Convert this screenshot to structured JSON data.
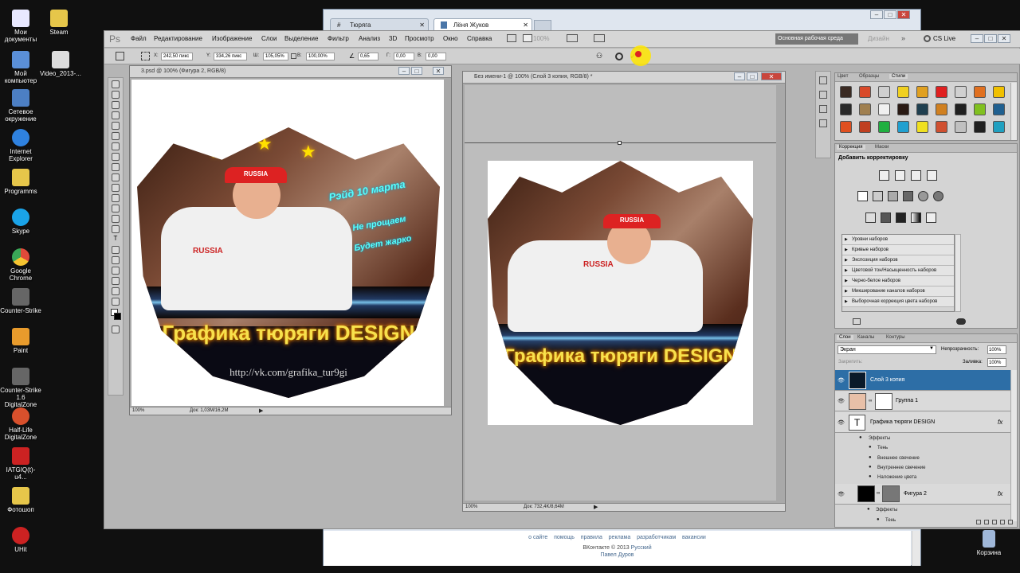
{
  "desktop": {
    "icons": [
      {
        "label": "Мои документы",
        "color": "#e8e8ff"
      },
      {
        "label": "Steam",
        "color": "#e6c64a"
      },
      {
        "label": "Мой компьютер",
        "color": "#5a8fd8"
      },
      {
        "label": "Video_2013-...",
        "color": "#dddddd"
      },
      {
        "label": "Сетевое окружение",
        "color": "#4c7fc4"
      },
      {
        "label": "Internet Explorer",
        "color": "#2f82e0"
      },
      {
        "label": "Programms",
        "color": "#e6c64a"
      },
      {
        "label": "Skype",
        "color": "#1aa3e8"
      },
      {
        "label": "Google Chrome",
        "color": "#e04a3a"
      },
      {
        "label": "Counter-Strike",
        "color": "#666666"
      },
      {
        "label": "Paint",
        "color": "#e89b2c"
      },
      {
        "label": "Counter-Strike 1.6 DigitalZone",
        "color": "#666666"
      },
      {
        "label": "Half-Life DigitalZone",
        "color": "#d8502c"
      },
      {
        "label": "IATGIQ(t)-u4...",
        "color": "#cc2222"
      },
      {
        "label": "Фотошоп",
        "color": "#e6c64a"
      },
      {
        "label": "UHit",
        "color": "#cc2222"
      }
    ],
    "recycle_bin": "Корзина"
  },
  "browser": {
    "tabs": [
      {
        "label": "Тюряга",
        "active": false
      },
      {
        "label": "Лёня Жуков",
        "active": true
      }
    ],
    "footer": {
      "links": [
        "о сайте",
        "помощь",
        "правила",
        "реклама",
        "разработчикам",
        "вакансии"
      ],
      "copyright": "ВКонтакте © 2013",
      "language": "Русский",
      "author": "Павел Дуров"
    }
  },
  "photoshop": {
    "logo": "Ps",
    "menu": [
      "Файл",
      "Редактирование",
      "Изображение",
      "Слои",
      "Выделение",
      "Фильтр",
      "Анализ",
      "3D",
      "Просмотр",
      "Окно",
      "Справка"
    ],
    "zoom": "100%",
    "workspace": "Основная рабочая среда",
    "design": "Дизайн",
    "cslive": "CS Live",
    "options": {
      "x_label": "X:",
      "x_value": "242,50 пикс",
      "y_label": "Y:",
      "y_value": "334,26 пикс",
      "w_label": "Ш:",
      "w_value": "105,05%",
      "h_label": "В:",
      "h_value": "100,00%",
      "angle_value": "0,65",
      "gh_label": "Г:",
      "gh_value": "0,00",
      "gv_label": "В:",
      "gv_value": "0,00"
    },
    "doc1": {
      "title": "3.psd @ 100% (Фигура 2, RGB/8)",
      "zoom": "100%",
      "doc_info": "Док: 1,03M/16,2M",
      "badge_lines": [
        "Рэйд 10 марта",
        "Не прощаем",
        "Будет жарко"
      ],
      "badge_title": "Графика тюряги DESIGN",
      "badge_url": "http://vk.com/grafika_tur9gi",
      "cap_text": "RUSSIA",
      "jacket_text": "RUSSIA"
    },
    "doc2": {
      "title": "Без имени-1 @ 100% (Слой 3 копия, RGB/8) *",
      "zoom": "100%",
      "doc_info": "Док: 732,4K/8,64M",
      "badge_title": "Графика тюряги DESIGN",
      "cap_text": "RUSSIA",
      "jacket_text": "RUSSIA"
    },
    "swatches_panel": {
      "tabs": [
        "Цвет",
        "Образцы",
        "Стили"
      ],
      "colors": [
        "#3a2a22",
        "#d94a2a",
        "#cfcfcf",
        "#f0d020",
        "#e0a020",
        "#e02020",
        "#d0d0d0",
        "#e07020",
        "#f0c000",
        "#2a2a2a",
        "#a08050",
        "#f0f0f0",
        "#2a1a14",
        "#204050",
        "#d08020",
        "#202020",
        "#80c020",
        "#206090",
        "#e05020",
        "#c04020",
        "#20b040",
        "#20a0d0",
        "#f0e020",
        "#d05030",
        "#c0c0c0",
        "#202020",
        "#20a0c0"
      ]
    },
    "adjustments_panel": {
      "tabs": [
        "Коррекция",
        "Маски"
      ],
      "heading": "Добавить корректировку",
      "presets": [
        "Уровни наборов",
        "Кривые наборов",
        "Экспозиция наборов",
        "Цветовой тон/Насыщенность наборов",
        "Черно-белое наборов",
        "Микширование каналов наборов",
        "Выборочная коррекция цвета наборов"
      ]
    },
    "layers_panel": {
      "tabs": [
        "Слои",
        "Каналы",
        "Контуры"
      ],
      "blend_mode": "Экран",
      "opacity_label": "Непрозрачность:",
      "opacity_value": "100%",
      "lock_label": "Закрепить:",
      "fill_label": "Заливка:",
      "fill_value": "100%",
      "layers": [
        {
          "name": "Слой 3 копия",
          "selected": true
        },
        {
          "name": "Группа 1",
          "selected": false
        },
        {
          "name": "Графика тюряги DESIGN",
          "selected": false
        },
        {
          "name": "Фигура 2",
          "selected": false
        }
      ],
      "effects_label": "Эффекты",
      "text_effects": [
        "Тень",
        "Внешнее свечение",
        "Внутреннее свечение",
        "Наложение цвета"
      ],
      "shape_effects_label": "Эффекты",
      "shape_effect_first": "Тень"
    }
  }
}
